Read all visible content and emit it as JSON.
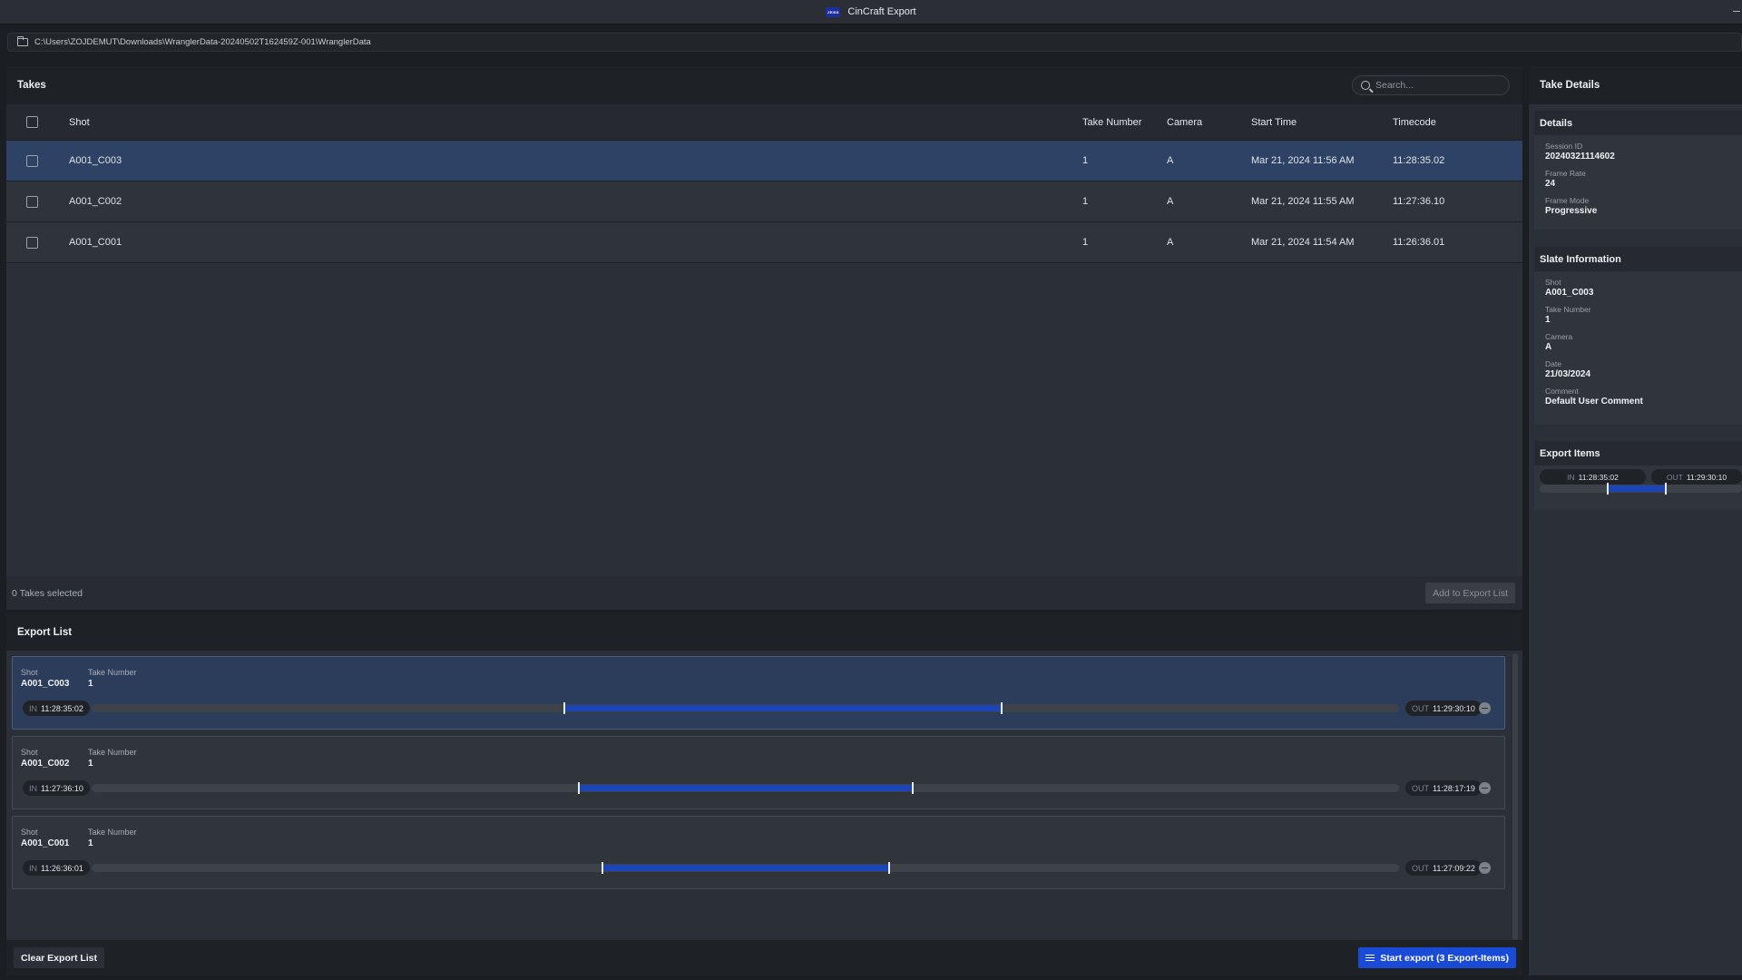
{
  "window": {
    "title": "CinCraft Export",
    "logo_text": "ZEISS"
  },
  "path": "C:\\Users\\ZOJDEMUT\\Downloads\\WranglerData-20240502T162459Z-001\\WranglerData",
  "takes": {
    "header": "Takes",
    "search_placeholder": "Search...",
    "columns": {
      "shot": "Shot",
      "take_number": "Take Number",
      "camera": "Camera",
      "start_time": "Start Time",
      "timecode": "Timecode"
    },
    "rows": [
      {
        "shot": "A001_C003",
        "take_number": "1",
        "camera": "A",
        "start_time": "Mar 21, 2024 11:56 AM",
        "timecode": "11:28:35.02",
        "selected": true
      },
      {
        "shot": "A001_C002",
        "take_number": "1",
        "camera": "A",
        "start_time": "Mar 21, 2024 11:55 AM",
        "timecode": "11:27:36.10",
        "selected": false
      },
      {
        "shot": "A001_C001",
        "take_number": "1",
        "camera": "A",
        "start_time": "Mar 21, 2024 11:54 AM",
        "timecode": "11:26:36.01",
        "selected": false
      }
    ],
    "selected_count": "0 Takes selected",
    "add_button": "Add to Export List"
  },
  "export": {
    "header": "Export List",
    "shot_label": "Shot",
    "take_label": "Take Number",
    "in_label": "IN",
    "out_label": "OUT",
    "items": [
      {
        "shot": "A001_C003",
        "take_number": "1",
        "in": "11:28:35:02",
        "out": "11:29:30:10",
        "range_start": 0.361,
        "range_end": 0.697
      },
      {
        "shot": "A001_C002",
        "take_number": "1",
        "in": "11:27:36:10",
        "out": "11:28:17:19",
        "range_start": 0.372,
        "range_end": 0.629
      },
      {
        "shot": "A001_C001",
        "take_number": "1",
        "in": "11:26:36:01",
        "out": "11:27:09:22",
        "range_start": 0.39,
        "range_end": 0.611
      }
    ],
    "clear_button": "Clear Export List",
    "start_button": "Start export (3 Export-Items)"
  },
  "details": {
    "header": "Take Details",
    "details_section": {
      "title": "Details",
      "fields": [
        {
          "label": "Session ID",
          "value": "20240321114602"
        },
        {
          "label": "Frame Rate",
          "value": "24"
        },
        {
          "label": "Frame Mode",
          "value": "Progressive"
        }
      ]
    },
    "slate_section": {
      "title": "Slate Information",
      "fields": [
        {
          "label": "Shot",
          "value": "A001_C003"
        },
        {
          "label": "Take Number",
          "value": "1"
        },
        {
          "label": "Camera",
          "value": "A"
        },
        {
          "label": "Date",
          "value": "21/03/2024"
        },
        {
          "label": "Comment",
          "value": "Default User Comment"
        }
      ]
    },
    "export_items_section": {
      "title": "Export Items",
      "in": "11:28:35:02",
      "out": "11:29:30:10",
      "range_start": 0.33,
      "range_end": 0.63
    }
  }
}
